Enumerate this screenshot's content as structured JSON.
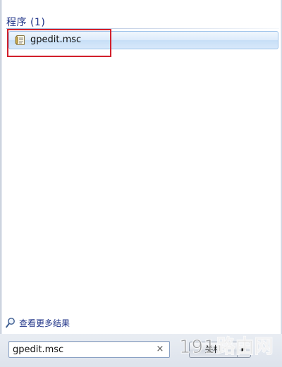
{
  "results": {
    "section_title": "程序 (1)",
    "items": [
      {
        "label": "gpedit.msc",
        "icon": "msc-file-icon"
      }
    ]
  },
  "more_results": {
    "label": "查看更多结果",
    "icon": "search-icon"
  },
  "search": {
    "value": "gpedit.msc",
    "clear_glyph": "×"
  },
  "shutdown": {
    "label": "关机",
    "arrow_glyph": "▶"
  },
  "watermark": {
    "digits": "191",
    "text": "路由网"
  },
  "colors": {
    "section_text": "#1e3287",
    "highlight_border": "#d21f2b",
    "selection_border": "#9cc2ea"
  }
}
